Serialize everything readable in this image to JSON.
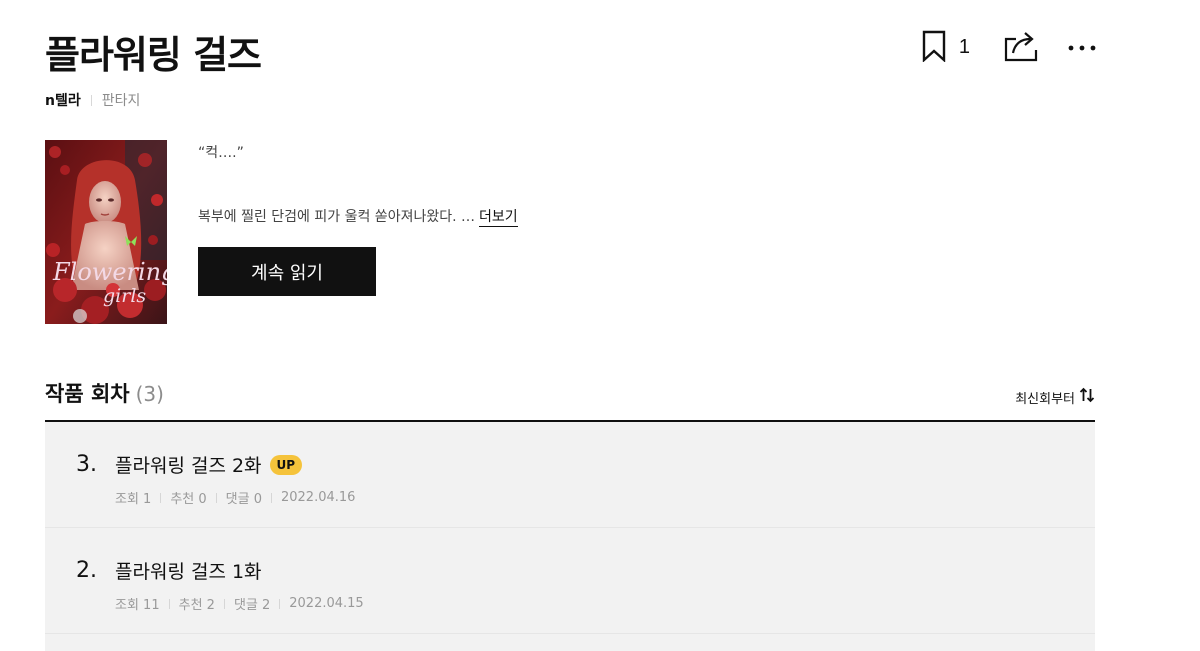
{
  "header": {
    "title": "플라워링 걸즈",
    "author": "n텔라",
    "genre": "판타지",
    "bookmark_count": "1"
  },
  "icons": {
    "bookmark": "bookmark-icon",
    "share": "share-icon",
    "more": "more-icon",
    "sort": "sort-arrows-icon"
  },
  "cover": {
    "logo_line1": "Flowering",
    "logo_line2": "girls"
  },
  "synopsis": {
    "line1": "“컥….”",
    "line2": "복부에 찔린 단검에 피가 울컥 쏟아져나왔다. …",
    "more_label": "더보기"
  },
  "read_button_label": "계속 읽기",
  "episodes_section": {
    "title": "작품 회차",
    "count": "(3)",
    "sort_label": "최신회부터"
  },
  "episodes": [
    {
      "number": "3.",
      "title": "플라워링 걸즈 2화",
      "badge": "UP",
      "views_label": "조회 1",
      "recs_label": "추천 0",
      "comments_label": "댓글 0",
      "date": "2022.04.16"
    },
    {
      "number": "2.",
      "title": "플라워링 걸즈 1화",
      "badge": "",
      "views_label": "조회 11",
      "recs_label": "추천 2",
      "comments_label": "댓글 2",
      "date": "2022.04.15"
    }
  ],
  "colors": {
    "badge": "#f5c33b",
    "button": "#111111",
    "list_bg": "#f2f2f2"
  }
}
